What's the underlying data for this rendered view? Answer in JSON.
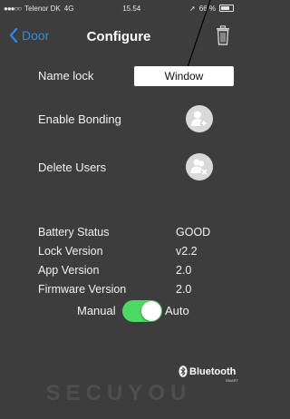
{
  "status_bar": {
    "signal": "●●●○○",
    "carrier": "Telenor DK",
    "network": "4G",
    "time": "15.54",
    "battery": "66 %"
  },
  "nav": {
    "back_label": "Door",
    "title": "Configure",
    "back_icon": "chevron-left-icon",
    "trash_icon": "trash-icon"
  },
  "name_lock": {
    "label": "Name lock",
    "value": "Window"
  },
  "enable_bonding": {
    "label": "Enable Bonding",
    "icon": "add-user-icon"
  },
  "delete_users": {
    "label": "Delete Users",
    "icon": "remove-user-icon"
  },
  "info": [
    {
      "key": "Battery Status",
      "value": "GOOD"
    },
    {
      "key": "Lock Version",
      "value": "v2.2"
    },
    {
      "key": "App Version",
      "value": "2.0"
    },
    {
      "key": "Firmware Version",
      "value": "2.0"
    }
  ],
  "mode": {
    "manual_label": "Manual",
    "auto_label": "Auto",
    "toggle_on": true,
    "toggle_color": "#4cd964"
  },
  "footer": {
    "bluetooth_label": "Bluetooth",
    "bluetooth_sub": "SMART",
    "brand": "SECUYOU"
  },
  "colors": {
    "background": "#3d3d3d",
    "accent": "#2e8ae6"
  }
}
